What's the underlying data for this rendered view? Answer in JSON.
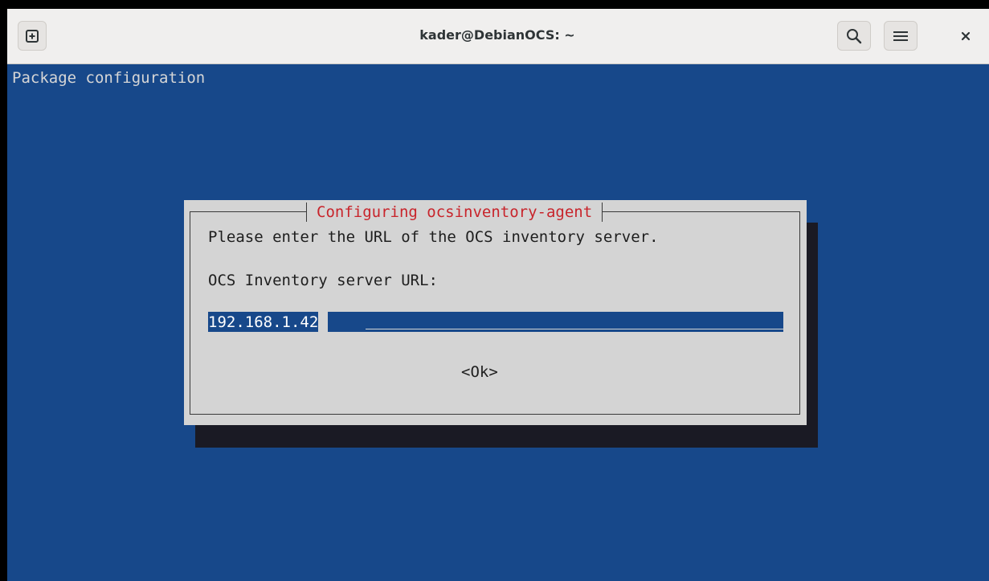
{
  "window": {
    "title": "kader@DebianOCS: ~"
  },
  "toolbar": {
    "new_tab_icon": "new-tab-icon",
    "search_icon": "search-icon",
    "menu_icon": "hamburger-menu-icon",
    "close_icon": "close-icon"
  },
  "terminal": {
    "header": "Package configuration",
    "background_color": "#17488a"
  },
  "dialog": {
    "title": "Configuring ocsinventory-agent",
    "prompt": "Please enter the URL of the OCS inventory server.",
    "field_label": "OCS Inventory server URL:",
    "field_value": "192.168.1.42",
    "ok_label": "<Ok>",
    "title_color": "#c8242b"
  }
}
